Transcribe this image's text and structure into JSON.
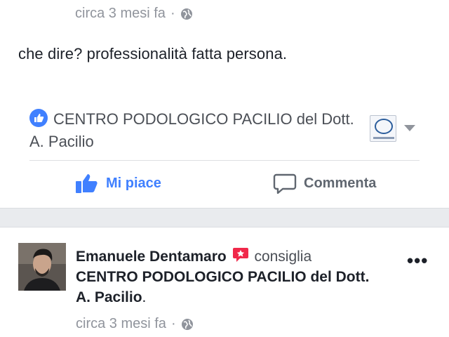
{
  "top_post": {
    "timestamp": "circa 3 mesi fa",
    "separator": "·",
    "privacy_icon": "globe-icon",
    "text": "che dire? professionalità fatta persona.",
    "page_name": "CENTRO PODOLOGICO PACILIO del Dott. A. Pacilio",
    "actions": {
      "like_label": "Mi piace",
      "comment_label": "Commenta"
    }
  },
  "next_post": {
    "author": "Emanuele Dentamaro",
    "verb": "consiglia",
    "page_name": "CENTRO PODOLOGICO PACILIO del Dott. A. Pacilio",
    "period": ".",
    "timestamp": "circa 3 mesi fa",
    "separator": "·",
    "privacy_icon": "globe-icon",
    "more_label": "•••"
  },
  "colors": {
    "accent": "#4080ff",
    "meta_gray": "#90949c",
    "text": "#1d2129",
    "recommend_red": "#f0284a",
    "band": "#e9ebee"
  }
}
